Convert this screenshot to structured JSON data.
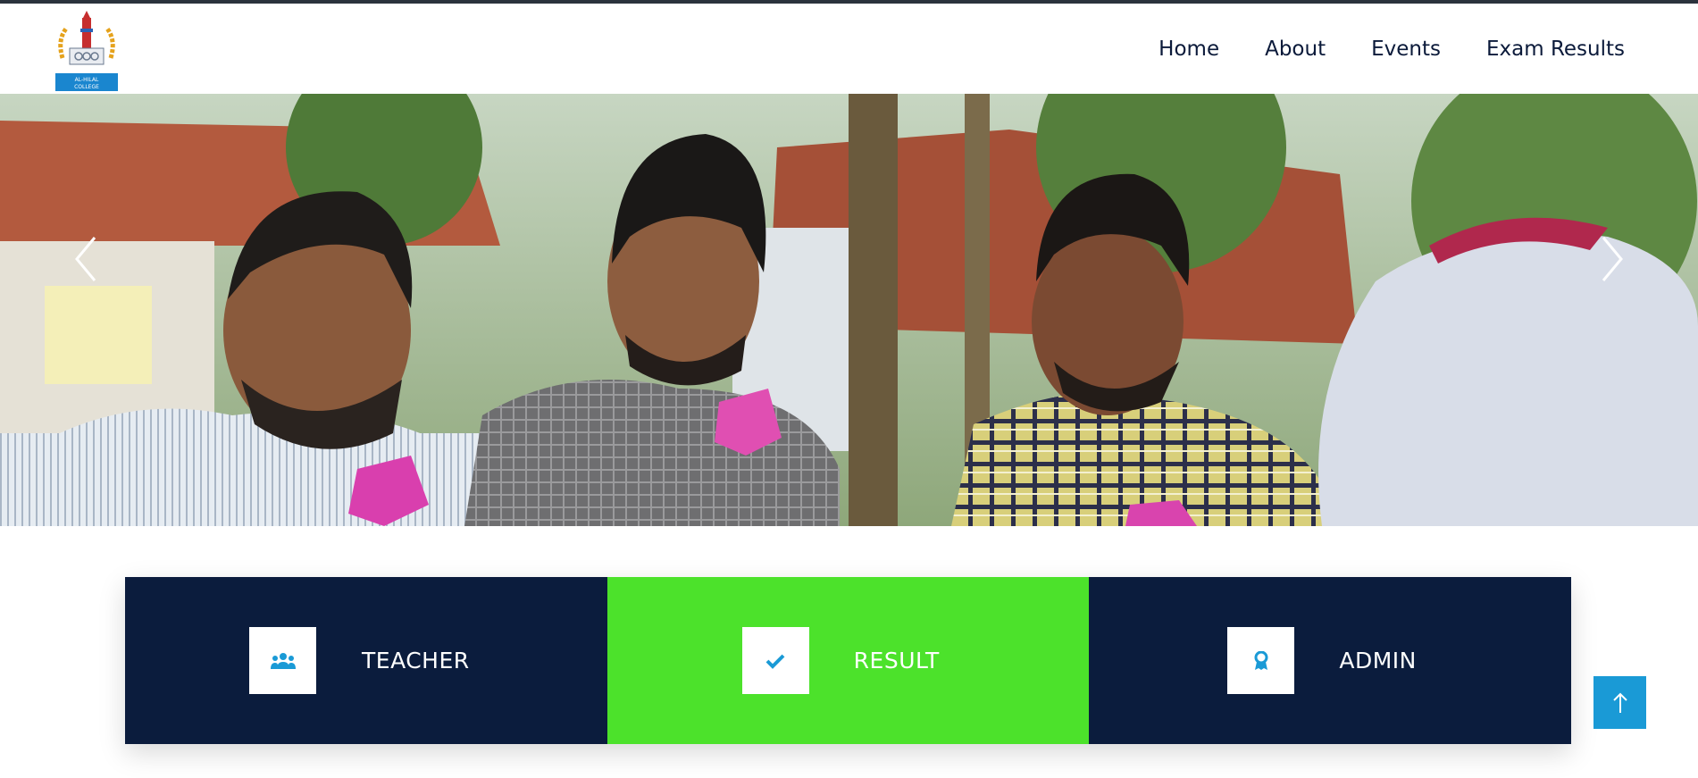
{
  "nav": {
    "links": [
      "Home",
      "About",
      "Events",
      "Exam Results"
    ]
  },
  "logo": {
    "name": "college-logo",
    "text_line1": "AL-HILAL",
    "text_line2": "COLLEGE"
  },
  "hero": {
    "prev_icon": "chevron-left-icon",
    "next_icon": "chevron-right-icon"
  },
  "features": [
    {
      "label": "TEACHER",
      "icon": "users-icon",
      "bg": "#0b1c3d"
    },
    {
      "label": "RESULT",
      "icon": "check-icon",
      "bg": "#4ce22b"
    },
    {
      "label": "ADMIN",
      "icon": "award-icon",
      "bg": "#0b1c3d"
    }
  ],
  "colors": {
    "navy": "#0b1c3d",
    "green": "#4ce22b",
    "accent_blue": "#1a9ad6"
  },
  "back_to_top": {
    "icon": "arrow-up-icon"
  }
}
